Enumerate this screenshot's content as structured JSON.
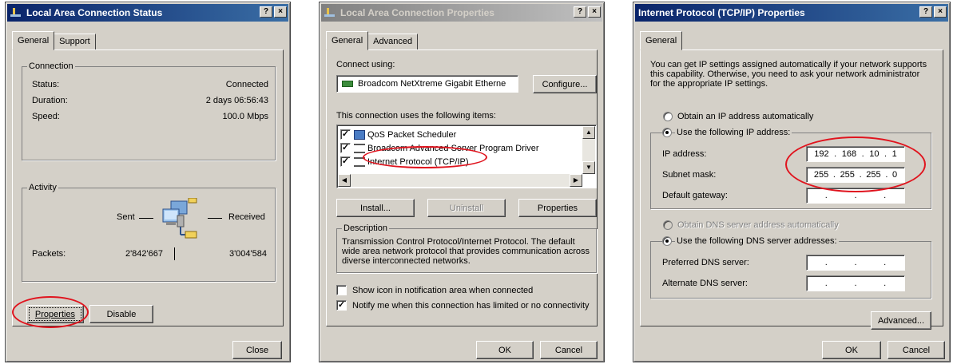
{
  "status_dialog": {
    "title": "Local Area Connection Status",
    "help": "?",
    "close_x": "×",
    "tabs": [
      "General",
      "Support"
    ],
    "connection_group": "Connection",
    "status_label": "Status:",
    "status_value": "Connected",
    "duration_label": "Duration:",
    "duration_value": "2 days 06:56:43",
    "speed_label": "Speed:",
    "speed_value": "100.0 Mbps",
    "activity_group": "Activity",
    "sent_label": "Sent",
    "received_label": "Received",
    "packets_label": "Packets:",
    "packets_sent": "2'842'667",
    "packets_received": "3'004'584",
    "properties_button": "Properties",
    "disable_button": "Disable",
    "close_button": "Close"
  },
  "properties_dialog": {
    "title": "Local Area Connection Properties",
    "help": "?",
    "close_x": "×",
    "tabs": [
      "General",
      "Advanced"
    ],
    "connect_using_label": "Connect using:",
    "adapter_name": "Broadcom NetXtreme Gigabit Etherne",
    "configure_button": "Configure...",
    "items_label": "This connection uses the following items:",
    "items": [
      {
        "label": "QoS Packet Scheduler",
        "checked": true
      },
      {
        "label": "Broadcom Advanced Server Program Driver",
        "checked": true
      },
      {
        "label": "Internet Protocol (TCP/IP)",
        "checked": true
      }
    ],
    "install_button": "Install...",
    "uninstall_button": "Uninstall",
    "properties_button": "Properties",
    "description_group": "Description",
    "description_text": "Transmission Control Protocol/Internet Protocol. The default wide area network protocol that provides communication across diverse interconnected networks.",
    "show_icon_label": "Show icon in notification area when connected",
    "notify_label": "Notify me when this connection has limited or no connectivity",
    "ok_button": "OK",
    "cancel_button": "Cancel"
  },
  "tcpip_dialog": {
    "title": "Internet Protocol (TCP/IP) Properties",
    "help": "?",
    "close_x": "×",
    "tabs": [
      "General"
    ],
    "intro_text": "You can get IP settings assigned automatically if your network supports this capability. Otherwise, you need to ask your network administrator for the appropriate IP settings.",
    "obtain_ip_label": "Obtain an IP address automatically",
    "use_ip_label": "Use the following IP address:",
    "ip_address_label": "IP address:",
    "ip_address": [
      "192",
      "168",
      "10",
      "1"
    ],
    "subnet_label": "Subnet mask:",
    "subnet_mask": [
      "255",
      "255",
      "255",
      "0"
    ],
    "gateway_label": "Default gateway:",
    "obtain_dns_label": "Obtain DNS server address automatically",
    "use_dns_label": "Use the following DNS server addresses:",
    "preferred_dns_label": "Preferred DNS server:",
    "alternate_dns_label": "Alternate DNS server:",
    "ip_dot": ".",
    "advanced_button": "Advanced...",
    "ok_button": "OK",
    "cancel_button": "Cancel"
  },
  "colors": {
    "dialog_face": "#d4d0c8",
    "title_active": "#0a246a",
    "highlight_ring": "#e0141e"
  }
}
